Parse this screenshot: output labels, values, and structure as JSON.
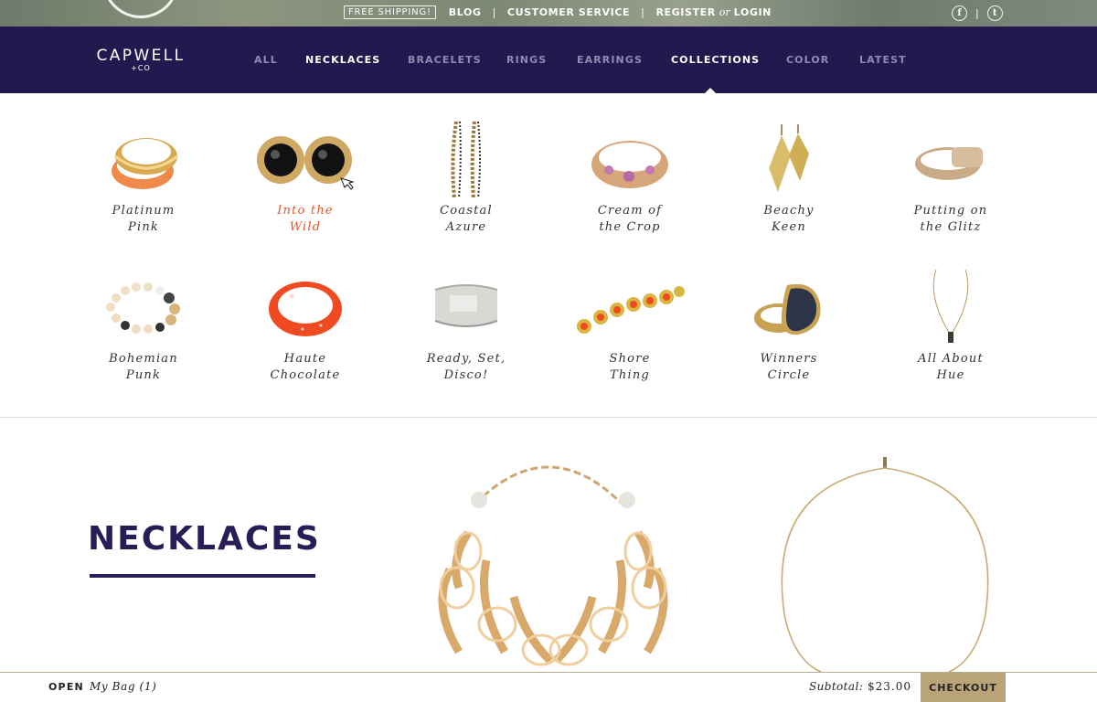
{
  "utility": {
    "promo": "FREE SHIPPING!",
    "blog": "BLOG",
    "service": "CUSTOMER SERVICE",
    "register": "REGISTER",
    "or": "or",
    "login": "LOGIN",
    "sep": "|"
  },
  "social": {
    "facebook": "f",
    "twitter": "t",
    "sep": "|"
  },
  "brand": {
    "name": "CAPWELL",
    "sub": "+CO"
  },
  "nav": [
    {
      "label": "ALL",
      "active": false
    },
    {
      "label": "NECKLACES",
      "active": true
    },
    {
      "label": "BRACELETS",
      "active": false
    },
    {
      "label": "RINGS",
      "active": false
    },
    {
      "label": "EARRINGS",
      "active": false
    },
    {
      "label": "COLLECTIONS",
      "active": true
    },
    {
      "label": "COLOR",
      "active": false
    },
    {
      "label": "LATEST",
      "active": false
    }
  ],
  "collections": [
    {
      "line1": "Platinum",
      "line2": "Pink",
      "icon": "orange-gold-bangles-icon"
    },
    {
      "line1": "Into the",
      "line2": "Wild",
      "icon": "black-stud-earrings-icon",
      "highlight": true
    },
    {
      "line1": "Coastal",
      "line2": "Azure",
      "icon": "chain-drop-earrings-icon"
    },
    {
      "line1": "Cream of",
      "line2": "the Crop",
      "icon": "pink-stone-ring-icon"
    },
    {
      "line1": "Beachy",
      "line2": "Keen",
      "icon": "gold-leaf-earrings-icon"
    },
    {
      "line1": "Putting on",
      "line2": "the Glitz",
      "icon": "gold-signet-ring-icon"
    },
    {
      "line1": "Bohemian",
      "line2": "Punk",
      "icon": "beaded-bracelet-icon"
    },
    {
      "line1": "Haute",
      "line2": "Chocolate",
      "icon": "red-bangle-icon"
    },
    {
      "line1": "Ready, Set,",
      "line2": "Disco!",
      "icon": "silver-cuff-icon"
    },
    {
      "line1": "Shore",
      "line2": "Thing",
      "icon": "coral-link-bracelet-icon"
    },
    {
      "line1": "Winners",
      "line2": "Circle",
      "icon": "stone-cocktail-ring-icon"
    },
    {
      "line1": "All About",
      "line2": "Hue",
      "icon": "pendant-necklace-icon"
    }
  ],
  "colors": {
    "navy": "#24194f",
    "accent": "#e2542c",
    "gold": "#b9a479"
  },
  "section": {
    "title": "NECKLACES"
  },
  "bag": {
    "open": "OPEN",
    "label": "My Bag (1)",
    "subtotal_label": "Subtotal:",
    "subtotal_value": "$23.00",
    "checkout": "CHECKOUT"
  }
}
